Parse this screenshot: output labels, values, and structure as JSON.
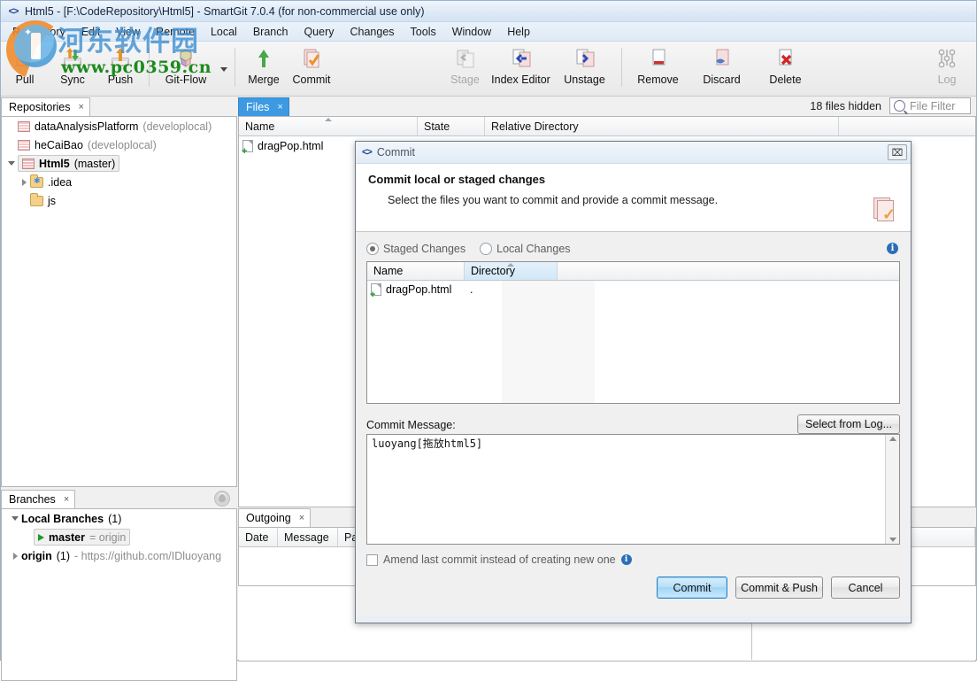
{
  "window": {
    "title": "Html5 - [F:\\CodeRepository\\Html5] - SmartGit 7.0.4 (for non-commercial use only)",
    "app_icon": "code-brackets-icon"
  },
  "menu": {
    "items": [
      "Repository",
      "Edit",
      "View",
      "Remote",
      "Local",
      "Branch",
      "Query",
      "Changes",
      "Tools",
      "Window",
      "Help"
    ]
  },
  "toolbar": {
    "items": [
      {
        "label": "Pull",
        "icon": "pull-icon",
        "disabled": false
      },
      {
        "label": "Sync",
        "icon": "sync-icon",
        "disabled": false
      },
      {
        "label": "Push",
        "icon": "push-icon",
        "disabled": false
      },
      {
        "label": "Git-Flow",
        "icon": "git-flow-icon",
        "disabled": false
      },
      {
        "label": "Merge",
        "icon": "merge-icon",
        "disabled": false
      },
      {
        "label": "Commit",
        "icon": "commit-icon",
        "disabled": false
      },
      {
        "label": "Stage",
        "icon": "stage-icon",
        "disabled": true
      },
      {
        "label": "Index Editor",
        "icon": "index-editor-icon",
        "disabled": false
      },
      {
        "label": "Unstage",
        "icon": "unstage-icon",
        "disabled": false
      },
      {
        "label": "Remove",
        "icon": "remove-icon",
        "disabled": false
      },
      {
        "label": "Discard",
        "icon": "discard-icon",
        "disabled": false
      },
      {
        "label": "Delete",
        "icon": "delete-icon",
        "disabled": false
      },
      {
        "label": "Log",
        "icon": "log-icon",
        "disabled": true
      }
    ]
  },
  "repositories": {
    "tab_label": "Repositories",
    "close_glyph": "×",
    "items": [
      {
        "name": "dataAnalysisPlatform",
        "branch": "(developlocal)",
        "indent": 1,
        "selected": false,
        "twisty": "none"
      },
      {
        "name": "heCaiBao",
        "branch": "(developlocal)",
        "indent": 1,
        "selected": false,
        "twisty": "none"
      },
      {
        "name": "Html5",
        "branch": "(master)",
        "indent": 1,
        "selected": true,
        "twisty": "open"
      }
    ],
    "folders": [
      {
        "name": ".idea",
        "indent": 2,
        "twisty": "closed",
        "icon": "folder-idea-icon"
      },
      {
        "name": "js",
        "indent": 2,
        "twisty": "none",
        "icon": "folder-icon"
      }
    ]
  },
  "branches": {
    "tab_label": "Branches",
    "close_glyph": "×",
    "github_icon": "github-icon",
    "rows": [
      {
        "label": "Local Branches",
        "count": "(1)",
        "twisty": "open",
        "type": "group"
      },
      {
        "label": "master",
        "suffix": "= origin",
        "type": "branch",
        "selected": true
      },
      {
        "label": "origin",
        "count": "(1)",
        "suffix": "- https://github.com/IDluoyang",
        "twisty": "closed",
        "type": "remote"
      }
    ]
  },
  "files_panel": {
    "tab_label": "Files",
    "close_glyph": "×",
    "hidden_label": "18 files hidden",
    "filter_placeholder": "File Filter",
    "filter_value": "",
    "columns": [
      "Name",
      "State",
      "Relative Directory"
    ],
    "sorted_column": "Name",
    "rows": [
      {
        "name": "dragPop.html",
        "state": "",
        "relative_directory": ""
      }
    ]
  },
  "outgoing_panel": {
    "tab_label": "Outgoing",
    "close_glyph": "×",
    "columns": [
      "Date",
      "Message",
      "Pa"
    ],
    "rows": []
  },
  "commit_dialog": {
    "title": "Commit",
    "title_icon": "code-brackets-icon",
    "close_glyph": "⌧",
    "heading": "Commit local or staged changes",
    "subheading": "Select the files you want to commit and provide a commit message.",
    "header_icon": "commit-pages-check-icon",
    "info_icon": "info-icon",
    "scope": {
      "options": [
        "Staged Changes",
        "Local Changes"
      ],
      "selected": "Staged Changes"
    },
    "table": {
      "columns": [
        "Name",
        "Directory"
      ],
      "sorted_column": "Directory",
      "rows": [
        {
          "name": "dragPop.html",
          "directory": "."
        }
      ]
    },
    "message_label": "Commit Message:",
    "select_from_log_label": "Select from Log...",
    "message_value": "luoyang[拖放html5]",
    "amend_label": "Amend last commit instead of creating new one",
    "amend_checked": false,
    "buttons": {
      "commit": "Commit",
      "commit_and_push": "Commit & Push",
      "cancel": "Cancel"
    }
  },
  "watermark": {
    "cn_text": "河东软件园",
    "url_text": "www.pc0359.cn",
    "cn_color": "#3f8fd0",
    "url_color": "#1c8a1c"
  },
  "colors": {
    "accent_tab": "#3d9ae2",
    "dialog_primary_button": "#9ed4f5",
    "title_gradient_top": "#eef5fc"
  }
}
